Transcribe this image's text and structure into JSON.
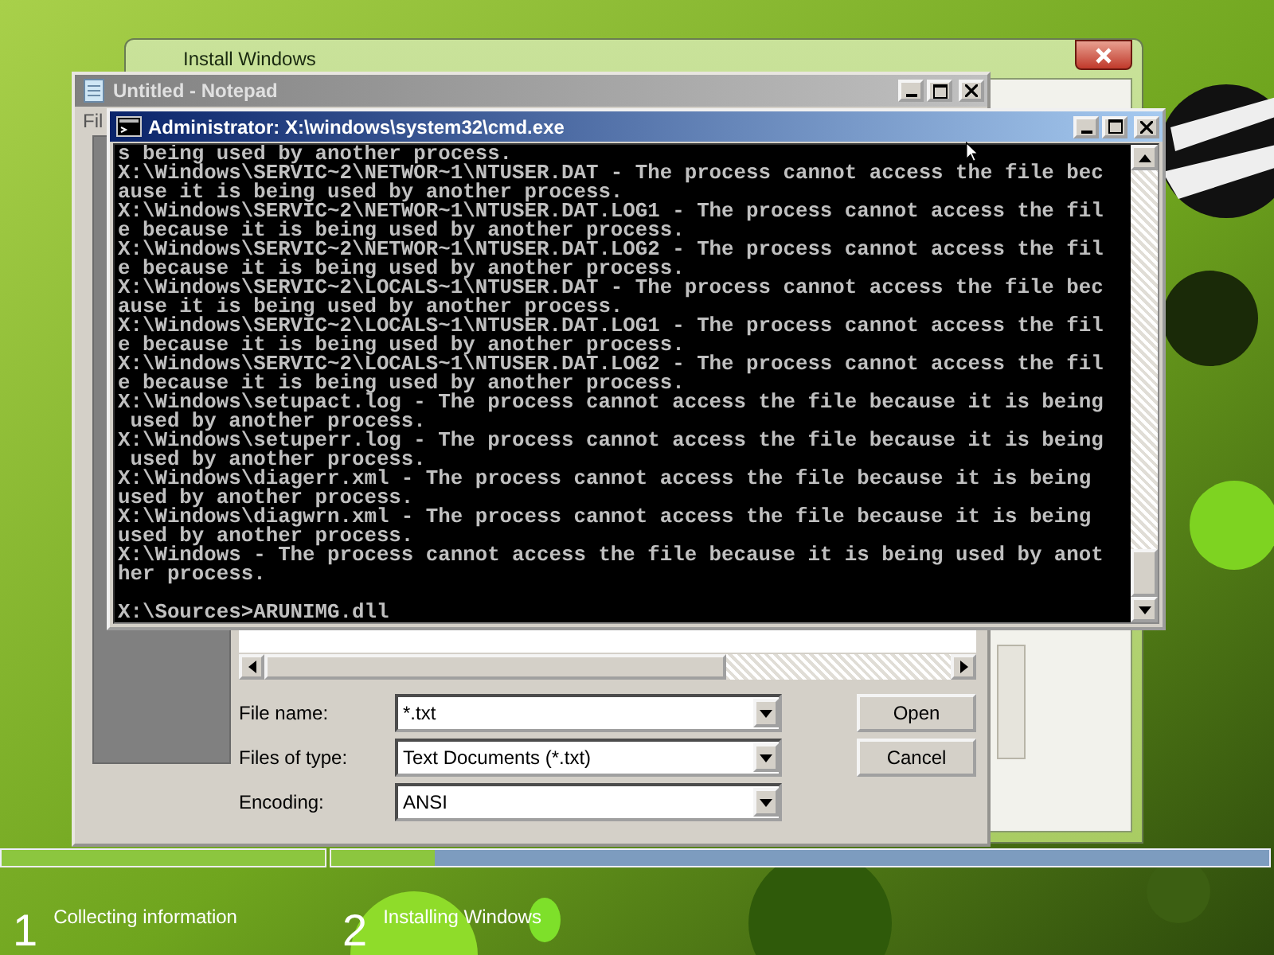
{
  "install_window": {
    "title": "Install Windows"
  },
  "notepad": {
    "title": "Untitled - Notepad",
    "menu": [
      "Fil"
    ],
    "open_dialog": {
      "fields": [
        {
          "label": "File name:",
          "value": "*.txt"
        },
        {
          "label": "Files of type:",
          "value": "Text Documents (*.txt)"
        },
        {
          "label": "Encoding:",
          "value": "ANSI"
        }
      ],
      "buttons": [
        "Open",
        "Cancel"
      ]
    }
  },
  "cmd": {
    "title": "Administrator: X:\\windows\\system32\\cmd.exe",
    "lines": [
      "s being used by another process.",
      "X:\\Windows\\SERVIC~2\\NETWOR~1\\NTUSER.DAT - The process cannot access the file bec",
      "ause it is being used by another process.",
      "X:\\Windows\\SERVIC~2\\NETWOR~1\\NTUSER.DAT.LOG1 - The process cannot access the fil",
      "e because it is being used by another process.",
      "X:\\Windows\\SERVIC~2\\NETWOR~1\\NTUSER.DAT.LOG2 - The process cannot access the fil",
      "e because it is being used by another process.",
      "X:\\Windows\\SERVIC~2\\LOCALS~1\\NTUSER.DAT - The process cannot access the file bec",
      "ause it is being used by another process.",
      "X:\\Windows\\SERVIC~2\\LOCALS~1\\NTUSER.DAT.LOG1 - The process cannot access the fil",
      "e because it is being used by another process.",
      "X:\\Windows\\SERVIC~2\\LOCALS~1\\NTUSER.DAT.LOG2 - The process cannot access the fil",
      "e because it is being used by another process.",
      "X:\\Windows\\setupact.log - The process cannot access the file because it is being",
      " used by another process.",
      "X:\\Windows\\setuperr.log - The process cannot access the file because it is being",
      " used by another process.",
      "X:\\Windows\\diagerr.xml - The process cannot access the file because it is being",
      "used by another process.",
      "X:\\Windows\\diagwrn.xml - The process cannot access the file because it is being",
      "used by another process.",
      "X:\\Windows - The process cannot access the file because it is being used by anot",
      "her process."
    ],
    "prompt": "X:\\Sources>ARUNIMG.dll"
  },
  "setup_steps": [
    {
      "number": "1",
      "label": "Collecting information",
      "level": 1
    },
    {
      "number": "2",
      "label": "Installing Windows",
      "level": 0.11
    }
  ]
}
